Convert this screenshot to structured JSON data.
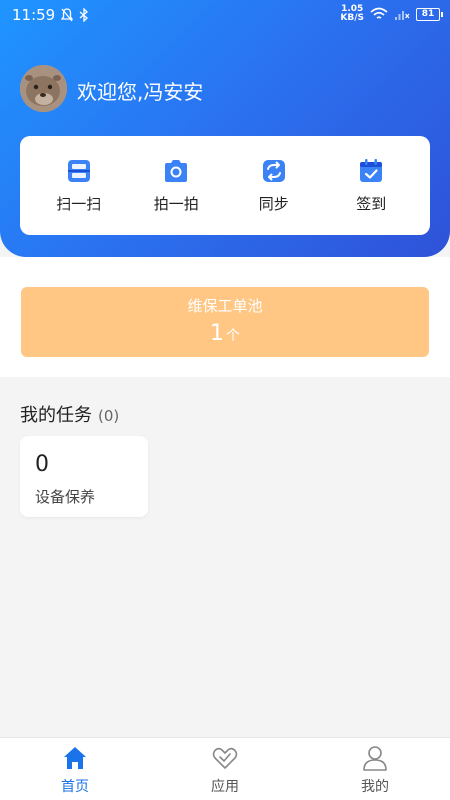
{
  "status_bar": {
    "time": "11:59",
    "net_speed_value": "1.05",
    "net_speed_unit": "KB/S",
    "battery": "81"
  },
  "header": {
    "welcome": "欢迎您,冯安安"
  },
  "quick_actions": [
    {
      "label": "扫一扫",
      "icon": "scan-icon"
    },
    {
      "label": "拍一拍",
      "icon": "camera-icon"
    },
    {
      "label": "同步",
      "icon": "sync-icon"
    },
    {
      "label": "签到",
      "icon": "calendar-check-icon"
    }
  ],
  "work_pool": {
    "title": "维保工单池",
    "count": "1",
    "unit": "个"
  },
  "tasks": {
    "title": "我的任务",
    "count": "(0)",
    "cards": [
      {
        "value": "0",
        "label": "设备保养"
      }
    ]
  },
  "tabbar": {
    "items": [
      {
        "label": "首页",
        "icon": "home-icon",
        "active": true
      },
      {
        "label": "应用",
        "icon": "apps-icon",
        "active": false
      },
      {
        "label": "我的",
        "icon": "profile-icon",
        "active": false
      }
    ]
  },
  "colors": {
    "brand_blue": "#1a73e8",
    "pool_orange": "#ffc684",
    "gradient_start": "#1e95ff",
    "gradient_end": "#2f52d8"
  }
}
